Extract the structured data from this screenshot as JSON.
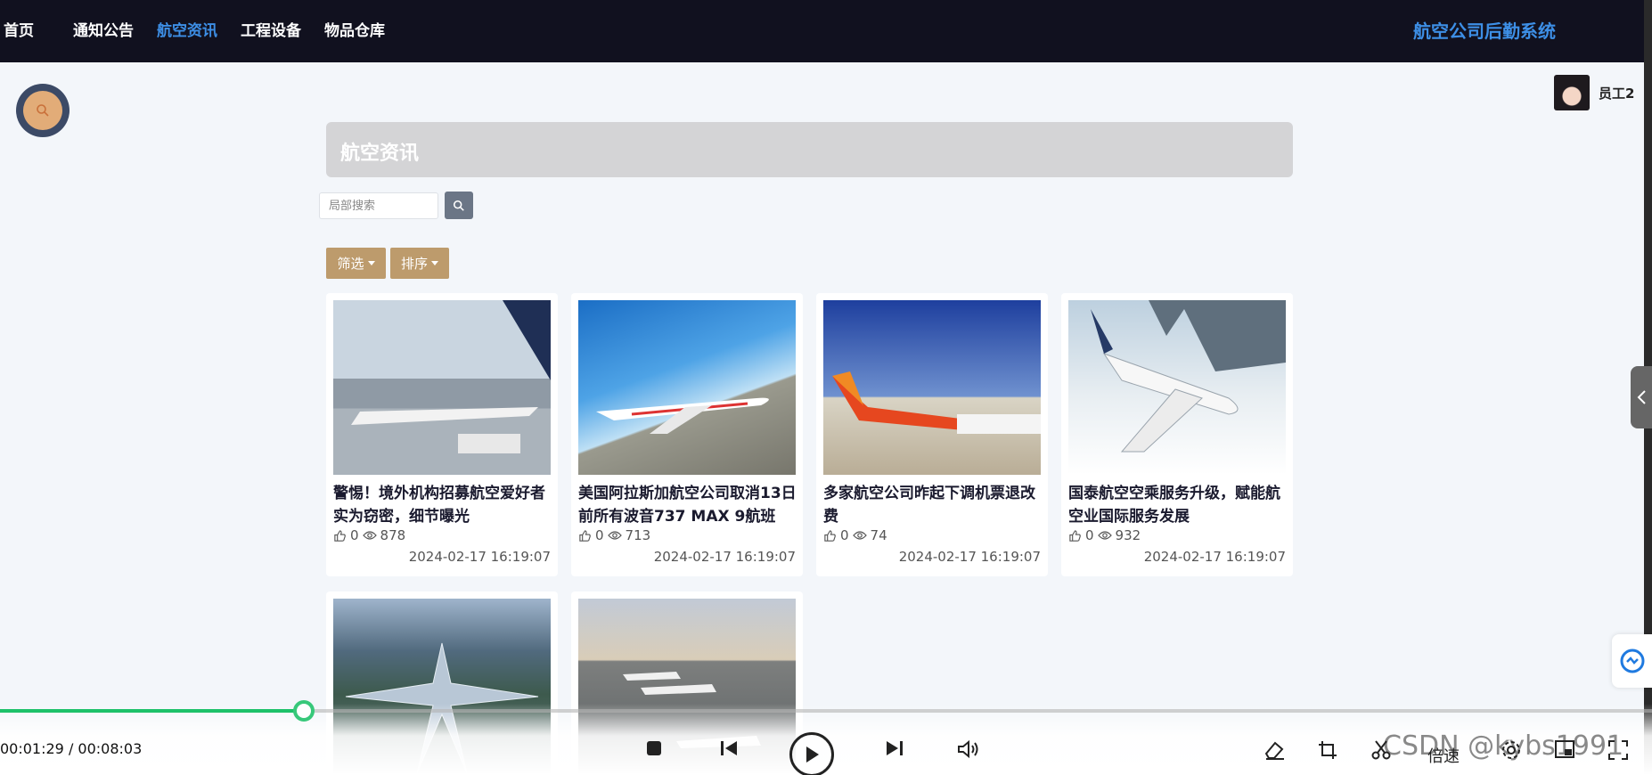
{
  "nav": {
    "items": [
      {
        "label": "首页",
        "active": false
      },
      {
        "label": "通知公告",
        "active": false
      },
      {
        "label": "航空资讯",
        "active": true
      },
      {
        "label": "工程设备",
        "active": false
      },
      {
        "label": "物品仓库",
        "active": false
      }
    ],
    "brand": "航空公司后勤系统"
  },
  "user": {
    "name": "员工2"
  },
  "page": {
    "title": "航空资讯"
  },
  "search": {
    "placeholder": "局部搜索"
  },
  "filters": {
    "filter_label": "筛选",
    "sort_label": "排序"
  },
  "articles": [
    {
      "title": "警惕！境外机构招募航空爱好者实为窃密，细节曝光",
      "likes": "0",
      "views": "878",
      "date": "2024-02-17 16:19:07",
      "image": "airport-apron-photo"
    },
    {
      "title": "美国阿拉斯加航空公司取消13日前所有波音737 MAX 9航班",
      "likes": "0",
      "views": "713",
      "date": "2024-02-17 16:19:07",
      "image": "white-jet-blue-sky-photo"
    },
    {
      "title": "多家航空公司昨起下调机票退改费",
      "likes": "0",
      "views": "74",
      "date": "2024-02-17 16:19:07",
      "image": "red-jet-terminal-photo"
    },
    {
      "title": "国泰航空空乘服务升级，赋能航空业国际服务发展",
      "likes": "0",
      "views": "932",
      "date": "2024-02-17 16:19:07",
      "image": "jet-above-clouds-photo"
    },
    {
      "title": "",
      "likes": "",
      "views": "",
      "date": "",
      "image": "airport-terminal-aerial-photo"
    },
    {
      "title": "",
      "likes": "",
      "views": "",
      "date": "",
      "image": "planes-on-runway-photo"
    }
  ],
  "player": {
    "time": "00:01:29 / 00:08:03",
    "progress_fraction": 0.184,
    "speed_label": "倍速",
    "watermark": "CSDN @kybs1991"
  },
  "colors": {
    "nav_bg": "#11111f",
    "accent_blue": "#3d8fe6",
    "button_tan": "#bd9b6c",
    "page_bg": "#f3f6fa",
    "progress_green": "#1ec16a"
  }
}
